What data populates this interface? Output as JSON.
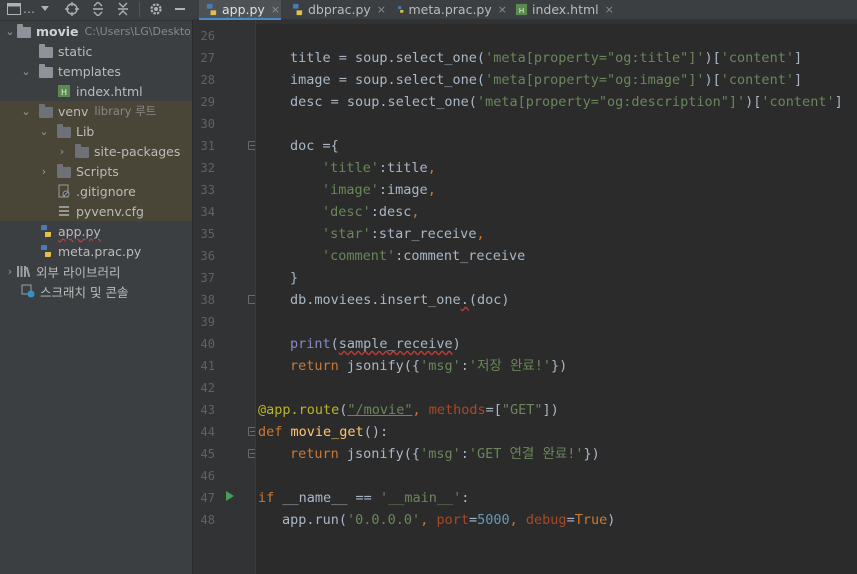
{
  "project_panel": {
    "toolbar": {
      "view_label": "…"
    },
    "tree": [
      {
        "label": "movie",
        "detail": "C:\\Users\\LG\\Deskto",
        "icon": "folder-icon",
        "bold": true
      },
      {
        "label": "static",
        "icon": "folder-icon"
      },
      {
        "label": "templates",
        "icon": "folder-icon"
      },
      {
        "label": "index.html",
        "icon": "html-file-icon"
      },
      {
        "label": "venv",
        "detail": "library 루트",
        "icon": "folder-icon"
      },
      {
        "label": "Lib",
        "icon": "folder-icon"
      },
      {
        "label": "site-packages",
        "icon": "folder-icon"
      },
      {
        "label": "Scripts",
        "icon": "folder-icon"
      },
      {
        "label": ".gitignore",
        "icon": "gitignore-file-icon"
      },
      {
        "label": "pyvenv.cfg",
        "icon": "config-file-icon"
      },
      {
        "label": "app.py",
        "icon": "python-file-icon"
      },
      {
        "label": "meta.prac.py",
        "icon": "python-file-icon"
      },
      {
        "label": "외부 라이브러리",
        "icon": "library-icon"
      },
      {
        "label": "스크래치 및 콘솔",
        "icon": "scratch-icon"
      }
    ]
  },
  "tabs": [
    {
      "label": "app.py",
      "close": "×",
      "active": true
    },
    {
      "label": "dbprac.py",
      "close": "×"
    },
    {
      "label": "meta.prac.py",
      "close": "×"
    },
    {
      "label": "index.html",
      "close": "×"
    }
  ],
  "editor": {
    "accent_color": "#4a88c7",
    "line_numbers": [
      "26",
      "27",
      "28",
      "29",
      "30",
      "31",
      "32",
      "33",
      "34",
      "35",
      "36",
      "37",
      "38",
      "39",
      "40",
      "41",
      "42",
      "43",
      "44",
      "45",
      "46",
      "47",
      "48"
    ]
  }
}
